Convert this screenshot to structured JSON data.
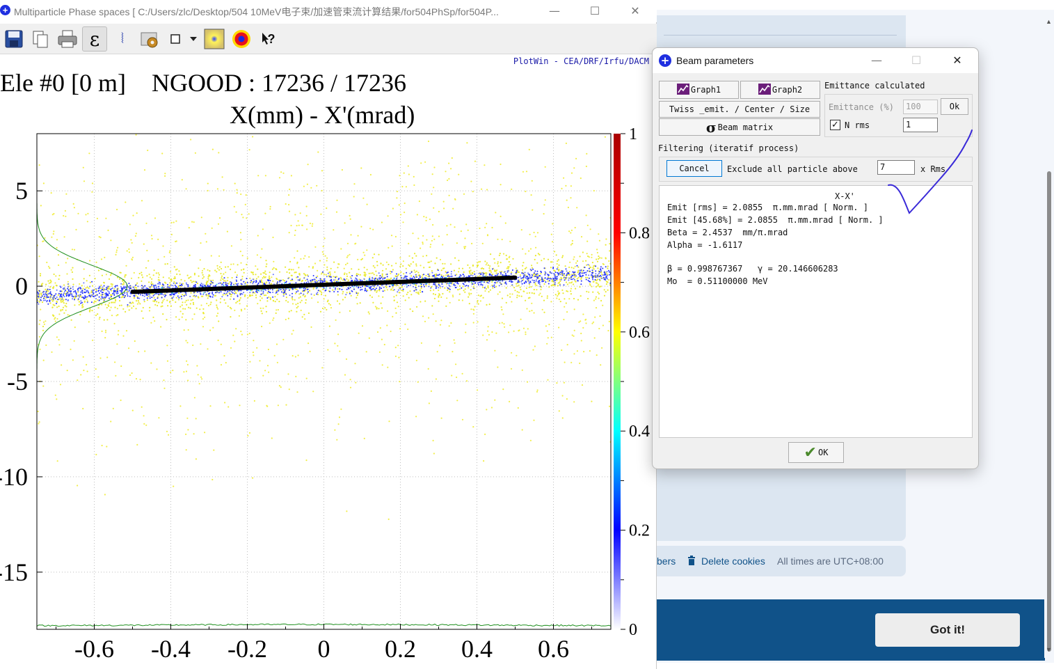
{
  "browser": {
    "links": [
      "bers",
      "Delete cookies",
      "All times are UTC+08:00"
    ],
    "cookie_button": "Got it!"
  },
  "plotwin": {
    "title": "Multiparticle Phase spaces [ C:/Users/zlc/Desktop/504 10MeV电子束/加速管束流计算结果/for504PhSp/for504P...",
    "controls": {
      "minimize": "—",
      "maximize": "☐",
      "close": "✕"
    },
    "toolbar_icons": [
      "save-icon",
      "copy-icon",
      "print-icon",
      "epsilon-icon",
      "bracket-icon",
      "settings-icon",
      "square-icon",
      "dropdown-icon",
      "density-map-icon",
      "color-circle-icon",
      "help-icon"
    ],
    "toolbar_glyphs": {
      "epsilon": "ε",
      "bracket": "⦚",
      "help": "?"
    },
    "credit": "PlotWin - CEA/DRF/Irfu/DACM",
    "header_element": "Ele #0 [0 m]",
    "header_ngood": "NGOOD : 17236 / 17236",
    "plot_title": "X(mm) - X'(mrad)"
  },
  "chart_data": {
    "type": "scatter",
    "title": "X(mm) - X'(mrad)",
    "xlabel": "X(mm)",
    "ylabel": "X'(mrad)",
    "x_ticks": [
      "-0.6",
      "-0.4",
      "-0.2",
      "0",
      "0.2",
      "0.4",
      "0.6"
    ],
    "y_ticks": [
      "5",
      "0",
      "-5",
      "-10",
      "-15"
    ],
    "xlim": [
      -0.75,
      0.75
    ],
    "ylim": [
      -18,
      8
    ],
    "grid": true,
    "colorbar_ticks": [
      "1",
      "0.8",
      "0.6",
      "0.4",
      "0.2",
      "0"
    ],
    "colorbar_range": [
      0,
      1
    ],
    "colorscale": [
      "#ffffff",
      "#0000ff",
      "#00ffff",
      "#ffff00",
      "#ff0000",
      "#aa0000"
    ],
    "points": 17236,
    "core_line": {
      "x": [
        -0.5,
        0.5
      ],
      "y": [
        -0.3,
        0.45
      ]
    }
  },
  "dialog": {
    "title": "Beam parameters",
    "controls": {
      "minimize": "—",
      "maximize": "☐",
      "close": "✕"
    },
    "graph1": "Graph1",
    "graph2": "Graph2",
    "twiss_button": "Twiss _emit. / Center / Size",
    "beam_matrix": "Beam matrix",
    "sigma_glyph": "σ",
    "emittance_calculated": "Emittance calculated",
    "emittance_label": "Emittance (%)",
    "emittance_value": "100",
    "ok_small": "Ok",
    "nrms_checked": "✓",
    "nrms_label": "N rms",
    "nrms_value": "1",
    "filtering_label": "Filtering (iteratif process)",
    "cancel": "Cancel",
    "exclude_label": "Exclude all particle above",
    "exclude_value": "7",
    "xrms_label": "x Rms",
    "results": {
      "heading": "X-X'",
      "lines": [
        "Emit [rms] = 2.0855  π.mm.mrad [ Norm. ]",
        "Emit [45.68%] = 2.0855  π.mm.mrad [ Norm. ]",
        "Beta = 2.4537  mm/π.mrad",
        "Alpha = -1.6117",
        "",
        "β = 0.998767367   γ = 20.146606283",
        "Mo  = 0.51100000 MeV"
      ]
    },
    "ok_big": "OK",
    "ok_check": "✔"
  }
}
